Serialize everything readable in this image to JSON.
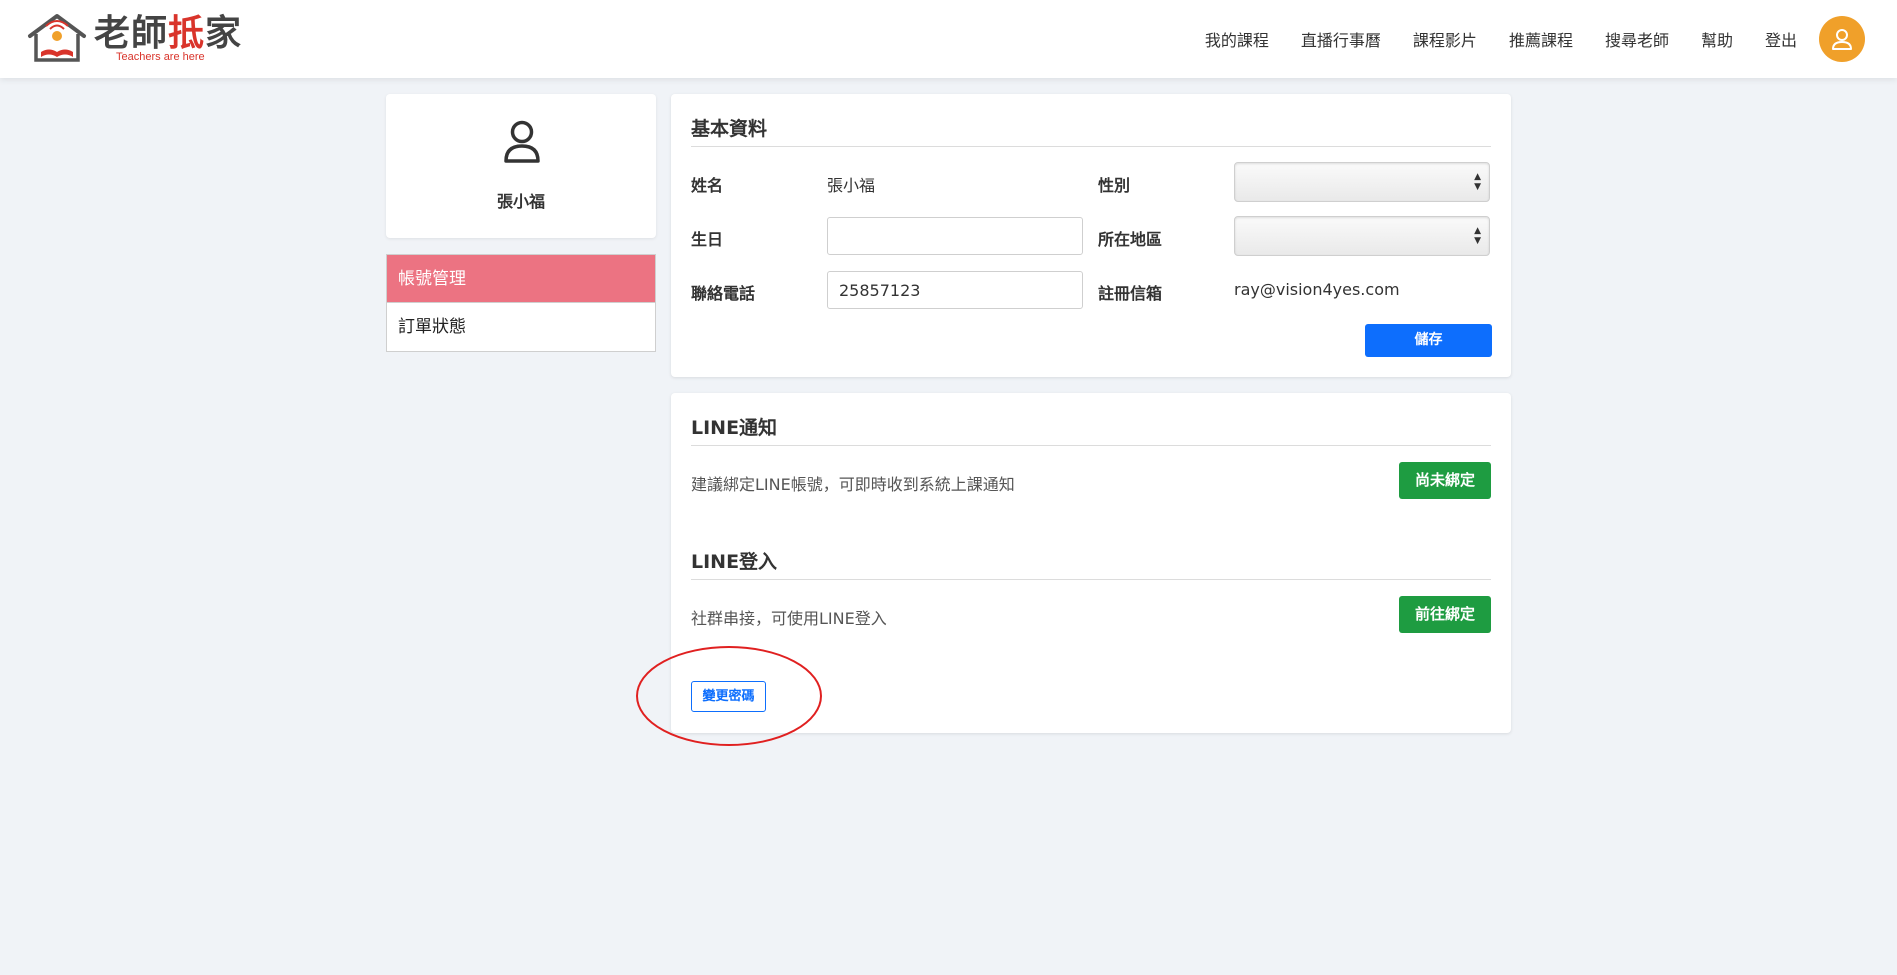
{
  "header": {
    "logo_name_part1": "老師",
    "logo_name_part2": "抵",
    "logo_name_part3": "家",
    "logo_tagline": "Teachers are here",
    "nav": [
      "我的課程",
      "直播行事曆",
      "課程影片",
      "推薦課程",
      "搜尋老師",
      "幫助",
      "登出"
    ],
    "avatar_icon": "user-icon",
    "accent_color": "#f0a02a"
  },
  "sidebar": {
    "profile_name": "張小福",
    "profile_icon": "user-outline-icon",
    "menu": [
      {
        "label": "帳號管理",
        "active": true
      },
      {
        "label": "訂單狀態",
        "active": false
      }
    ],
    "active_color": "#ec7382"
  },
  "basic_info": {
    "title": "基本資料",
    "name_label": "姓名",
    "name_value": "張小福",
    "gender_label": "性別",
    "gender_value": "",
    "birthday_label": "生日",
    "birthday_value": "",
    "region_label": "所在地區",
    "region_value": "",
    "phone_label": "聯絡電話",
    "phone_value": "25857123",
    "email_label": "註冊信箱",
    "email_value": "ray@vision4yes.com",
    "save_label": "儲存"
  },
  "line_notify": {
    "title": "LINE通知",
    "desc": "建議綁定LINE帳號，可即時收到系統上課通知",
    "button_label": "尚未綁定"
  },
  "line_login": {
    "title": "LINE登入",
    "desc": "社群串接，可使用LINE登入",
    "button_label": "前往綁定"
  },
  "change_password_label": "變更密碼",
  "colors": {
    "primary": "#0d6efd",
    "success": "#1e9c41",
    "annotation": "#e02020"
  }
}
